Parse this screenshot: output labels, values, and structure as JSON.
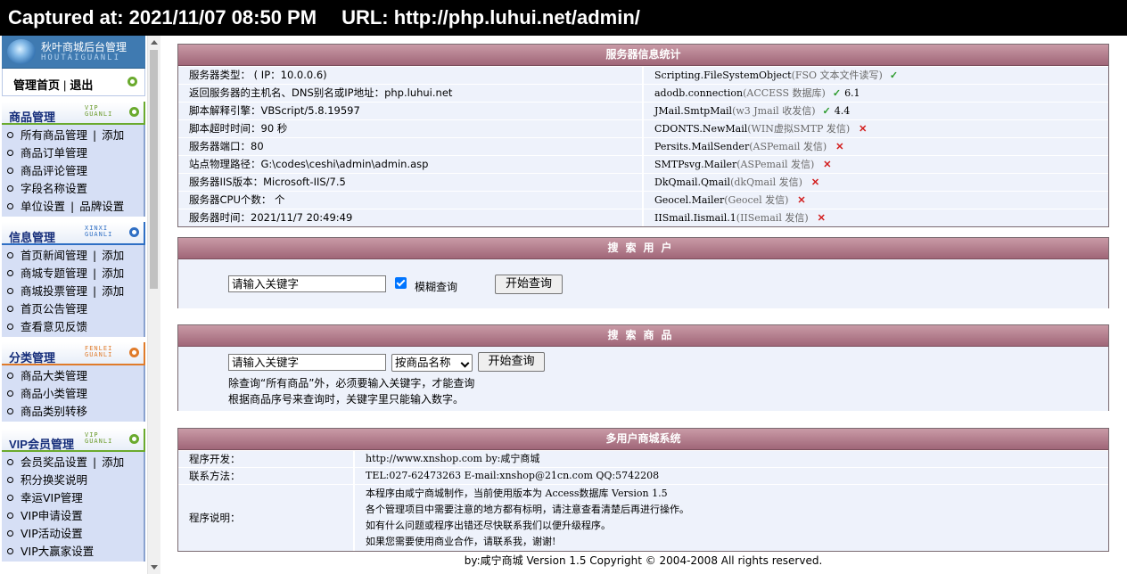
{
  "capture": {
    "label": "Captured at: 2021/11/07 08:50 PM",
    "url": "URL: http://php.luhui.net/admin/"
  },
  "logo": {
    "title": "秋叶商城后台管理",
    "sub": "HOUTAIGUANLI"
  },
  "home": {
    "home": "管理首页",
    "sep": "|",
    "logout": "退出"
  },
  "sections": [
    {
      "title": "商品管理",
      "sub1": "VIP",
      "sub2": "GUANLI",
      "items": [
        [
          "所有商品管理",
          "添加"
        ],
        [
          "商品订单管理"
        ],
        [
          "商品评论管理"
        ],
        [
          "字段名称设置"
        ],
        [
          "单位设置",
          "品牌设置"
        ]
      ]
    },
    {
      "title": "信息管理",
      "sub1": "XINXI",
      "sub2": "GUANLI",
      "items": [
        [
          "首页新闻管理",
          "添加"
        ],
        [
          "商城专题管理",
          "添加"
        ],
        [
          "商城投票管理",
          "添加"
        ],
        [
          "首页公告管理"
        ],
        [
          "查看意见反馈"
        ]
      ]
    },
    {
      "title": "分类管理",
      "sub1": "FENLEI",
      "sub2": "GUANLI",
      "items": [
        [
          "商品大类管理"
        ],
        [
          "商品小类管理"
        ],
        [
          "商品类别转移"
        ]
      ]
    },
    {
      "title": "VIP会员管理",
      "sub1": "VIP",
      "sub2": "GUANLI",
      "items": [
        [
          "会员奖品设置",
          "添加"
        ],
        [
          "积分换奖说明"
        ],
        [
          "幸运VIP管理"
        ],
        [
          "VIP申请设置"
        ],
        [
          "VIP活动设置"
        ],
        [
          "VIP大赢家设置"
        ]
      ]
    }
  ],
  "server": {
    "title": "服务器信息统计",
    "rows": [
      {
        "left": "服务器类型：  ( IP：10.0.0.6)",
        "comp": "Scripting.FileSystemObject",
        "desc": "(FSO 文本文件读写)",
        "ok": true,
        "ver": ""
      },
      {
        "left": "返回服务器的主机名、DNS别名或IP地址：php.luhui.net",
        "comp": "adodb.connection",
        "desc": "(ACCESS 数据库)",
        "ok": true,
        "ver": "6.1"
      },
      {
        "left": "脚本解释引擎：VBScript/5.8.19597",
        "comp": "JMail.SmtpMail",
        "desc": "(w3 Jmail 收发信)",
        "ok": true,
        "ver": "4.4"
      },
      {
        "left": "脚本超时时间：90 秒",
        "comp": "CDONTS.NewMail",
        "desc": "(WIN虚拟SMTP 发信)",
        "ok": false,
        "ver": ""
      },
      {
        "left": "服务器端口：80",
        "comp": "Persits.MailSender",
        "desc": "(ASPemail 发信)",
        "ok": false,
        "ver": ""
      },
      {
        "left": "站点物理路径：G:\\codes\\ceshi\\admin\\admin.asp",
        "comp": "SMTPsvg.Mailer",
        "desc": "(ASPemail 发信)",
        "ok": false,
        "ver": ""
      },
      {
        "left": "服务器IIS版本：Microsoft-IIS/7.5",
        "comp": "DkQmail.Qmail",
        "desc": "(dkQmail 发信)",
        "ok": false,
        "ver": ""
      },
      {
        "left": "服务器CPU个数： 个",
        "comp": "Geocel.Mailer",
        "desc": "(Geocel 发信)",
        "ok": false,
        "ver": ""
      },
      {
        "left": "服务器时间：2021/11/7 20:49:49",
        "comp": "IISmail.Iismail.1",
        "desc": "(IISemail 发信)",
        "ok": false,
        "ver": ""
      }
    ],
    "ok_mark": "✓",
    "no_mark": "✕"
  },
  "user_search": {
    "title": "搜索用户",
    "input_value": "请输入关键字",
    "fuzzy_label": "模糊查询",
    "button": "开始查询"
  },
  "product_search": {
    "title": "搜索商品",
    "input_value": "请输入关键字",
    "select_value": "按商品名称",
    "button": "开始查询",
    "note1": "除查询“所有商品”外，必须要输入关键字，才能查询",
    "note2": "根据商品序号来查询时，关键字里只能输入数字。"
  },
  "system": {
    "title": "多用户商城系统",
    "dev_label": "程序开发：",
    "dev_value": "http://www.xnshop.com by:咸宁商城",
    "contact_label": "联系方法：",
    "contact_value": "TEL:027-62473263 E-mail:xnshop@21cn.com QQ:5742208",
    "desc_label": "程序说明：",
    "desc_lines": [
      "本程序由咸宁商城制作，当前使用版本为 Access数据库 Version 1.5",
      "各个管理项目中需要注意的地方都有标明，请注意查看清楚后再进行操作。",
      "如有什么问题或程序出错还尽快联系我们以便升级程序。",
      "如果您需要使用商业合作，请联系我，谢谢!"
    ]
  },
  "footer": "by:咸宁商城 Version 1.5 Copyright © 2004-2008  All rights reserved."
}
